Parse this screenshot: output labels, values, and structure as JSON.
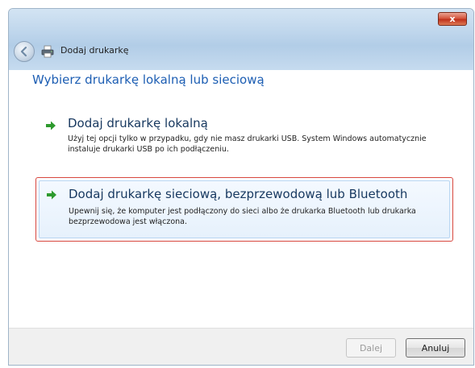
{
  "window": {
    "title": "Dodaj drukarkę",
    "close_symbol": "x"
  },
  "heading": "Wybierz drukarkę lokalną lub sieciową",
  "options": [
    {
      "title": "Dodaj drukarkę lokalną",
      "description": "Użyj tej opcji tylko w przypadku, gdy nie masz drukarki USB. System Windows automatycznie instaluje drukarki USB po ich podłączeniu.",
      "icon": "green-arrow-icon"
    },
    {
      "title": "Dodaj drukarkę sieciową, bezprzewodową lub Bluetooth",
      "description": "Upewnij się, że komputer jest podłączony do sieci albo że drukarka Bluetooth lub drukarka bezprzewodowa jest włączona.",
      "icon": "green-arrow-icon",
      "highlighted": true
    }
  ],
  "buttons": {
    "next_label": "Dalej",
    "cancel_label": "Anuluj"
  },
  "colors": {
    "heading": "#1d5eb3",
    "highlight_border": "#d9473e",
    "arrow": "#2e9a2e"
  }
}
